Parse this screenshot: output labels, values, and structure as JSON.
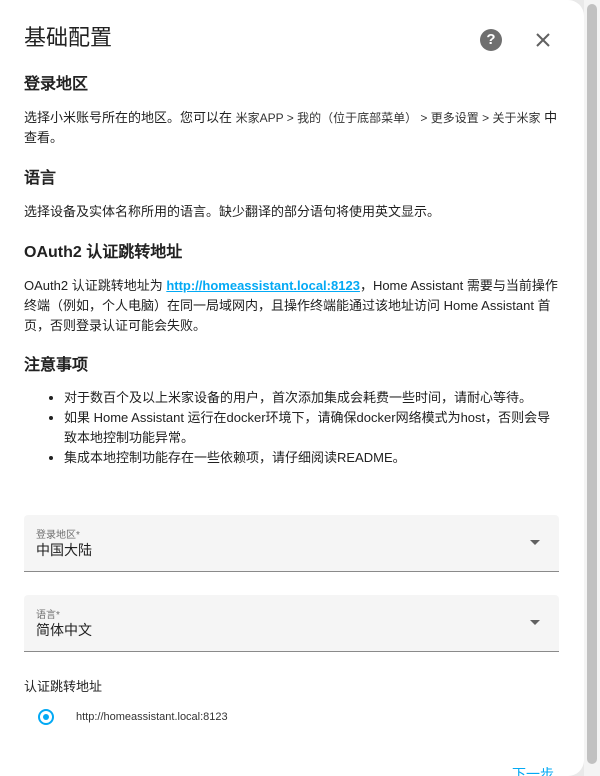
{
  "dialog": {
    "title": "基础配置",
    "help_icon": "help-circle-icon",
    "close_icon": "close-icon"
  },
  "sections": {
    "region": {
      "heading": "登录地区",
      "text_1": "选择小米账号所在的地区。您可以在 ",
      "text_2": "米家APP > 我的（位于底部菜单） > 更多设置 > 关于米家",
      "text_3": " 中查看。"
    },
    "language": {
      "heading": "语言",
      "text": "选择设备及实体名称所用的语言。缺少翻译的部分语句将使用英文显示。"
    },
    "oauth": {
      "heading": "OAuth2 认证跳转地址",
      "text_before": "OAuth2 认证跳转地址为 ",
      "link": "http://homeassistant.local:8123",
      "text_after": "，Home Assistant 需要与当前操作终端（例如，个人电脑）在同一局域网内，且操作终端能通过该地址访问 Home Assistant 首页，否则登录认证可能会失败。"
    },
    "notes": {
      "heading": "注意事项",
      "items": [
        "对于数百个及以上米家设备的用户，首次添加集成会耗费一些时间，请耐心等待。",
        "如果 Home Assistant 运行在docker环境下，请确保docker网络模式为host，否则会导致本地控制功能异常。",
        "集成本地控制功能存在一些依赖项，请仔细阅读README。"
      ]
    }
  },
  "fields": {
    "region": {
      "label": "登录地区*",
      "value": "中国大陆"
    },
    "language": {
      "label": "语言*",
      "value": "简体中文"
    }
  },
  "redirect": {
    "label": "认证跳转地址",
    "option": "http://homeassistant.local:8123"
  },
  "footer": {
    "next_label": "下一步"
  },
  "colors": {
    "accent": "#03a9f4",
    "text": "#212121",
    "field_bg": "#f5f5f5"
  }
}
